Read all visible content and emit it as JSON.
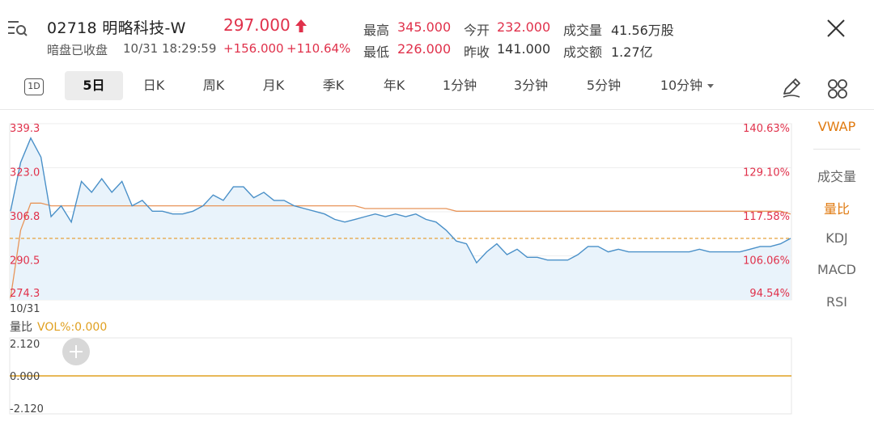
{
  "header": {
    "stock_code_name": "02718 明略科技-W",
    "price": "297.000",
    "status": "暗盘已收盘",
    "datetime": "10/31 18:29:59",
    "change": "+156.000",
    "change_pct": "+110.64%",
    "stats": {
      "high_label": "最高",
      "high": "345.000",
      "low_label": "最低",
      "low": "226.000",
      "open_label": "今开",
      "open": "232.000",
      "prev_close_label": "昨收",
      "prev_close": "141.000",
      "volume_label": "成交量",
      "volume": "41.56万股",
      "turnover_label": "成交额",
      "turnover": "1.27亿"
    },
    "colors": {
      "up": "#e0314b"
    }
  },
  "tabs": [
    {
      "label": "1D",
      "active": false
    },
    {
      "label": "5日",
      "active": true
    },
    {
      "label": "日K",
      "active": false
    },
    {
      "label": "周K",
      "active": false
    },
    {
      "label": "月K",
      "active": false
    },
    {
      "label": "季K",
      "active": false
    },
    {
      "label": "年K",
      "active": false
    },
    {
      "label": "1分钟",
      "active": false
    },
    {
      "label": "3分钟",
      "active": false
    },
    {
      "label": "5分钟",
      "active": false
    },
    {
      "label": "10分钟",
      "active": false,
      "dropdown": true
    }
  ],
  "indicators": [
    "VWAP",
    "成交量",
    "量比",
    "KDJ",
    "MACD",
    "RSI"
  ],
  "chart_data": [
    {
      "type": "line",
      "y_ticks_left": [
        "339.3",
        "323.0",
        "306.8",
        "290.5",
        "274.3"
      ],
      "y_ticks_right": [
        "140.63%",
        "129.10%",
        "117.58%",
        "106.06%",
        "94.54%"
      ],
      "x_tick_labels": [
        "10/31"
      ],
      "ylim": [
        274.3,
        339.3
      ],
      "reference_line": 297.0,
      "series": [
        {
          "name": "price",
          "color": "#4a90c8",
          "values": [
            307,
            325,
            334,
            327,
            305,
            309,
            303,
            318,
            314,
            319,
            314,
            318,
            309,
            311,
            307,
            307,
            306,
            306,
            307,
            309,
            313,
            311,
            316,
            316,
            312,
            314,
            311,
            311,
            309,
            308,
            307,
            306,
            304,
            303,
            304,
            305,
            306,
            305,
            306,
            305,
            306,
            304,
            303,
            300,
            296,
            295,
            288,
            292,
            295,
            291,
            293,
            290,
            290,
            289,
            289,
            289,
            291,
            294,
            294,
            292,
            293,
            292,
            292,
            292,
            292,
            292,
            292,
            292,
            293,
            292,
            292,
            292,
            292,
            293,
            294,
            294,
            295,
            297
          ]
        },
        {
          "name": "VWAP",
          "color": "#e8955a",
          "values": [
            275,
            300,
            310,
            310,
            309,
            309,
            309,
            309,
            309,
            309,
            309,
            309,
            309,
            309,
            309,
            309,
            309,
            309,
            309,
            309,
            309,
            309,
            309,
            309,
            309,
            309,
            309,
            309,
            309,
            309,
            309,
            309,
            309,
            309,
            309,
            308,
            308,
            308,
            308,
            308,
            308,
            308,
            308,
            308,
            307,
            307,
            307,
            307,
            307,
            307,
            307,
            307,
            307,
            307,
            307,
            307,
            307,
            307,
            307,
            307,
            307,
            307,
            307,
            307,
            307,
            307,
            307,
            307,
            307,
            307,
            307,
            307,
            307,
            307,
            307,
            307,
            307,
            306
          ]
        }
      ]
    },
    {
      "type": "line",
      "label": "量比",
      "legend": "VOL%:0.000",
      "y_ticks_left": [
        "2.120",
        "0.000",
        "-2.120"
      ],
      "ylim": [
        -2.12,
        2.12
      ],
      "series": [
        {
          "name": "VOL%",
          "color": "#e0a020",
          "values": [
            0,
            0
          ]
        }
      ]
    }
  ]
}
